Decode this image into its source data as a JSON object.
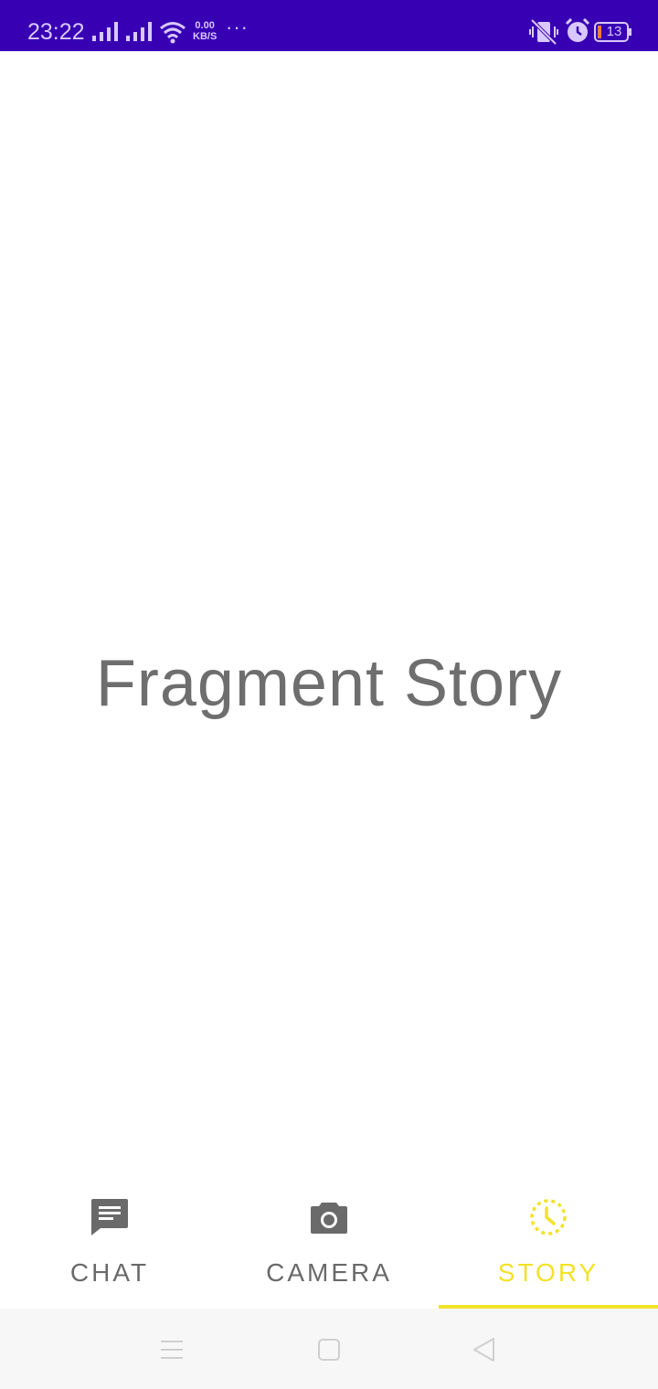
{
  "status_bar": {
    "time": "23:22",
    "net_speed_value": "0.00",
    "net_speed_unit": "KB/S",
    "more_indicator": "···",
    "battery_level": "13",
    "icons": [
      "signal-icon",
      "signal-icon",
      "wifi-icon",
      "vibrate-off-icon",
      "alarm-icon",
      "battery-icon"
    ]
  },
  "main": {
    "fragment_text": "Fragment Story"
  },
  "tabs": [
    {
      "label": "CHAT",
      "icon": "chat-icon",
      "selected": false
    },
    {
      "label": "CAMERA",
      "icon": "camera-icon",
      "selected": false
    },
    {
      "label": "STORY",
      "icon": "story-icon",
      "selected": true
    }
  ],
  "colors": {
    "status_bar": "#3700b3",
    "accent": "#f2e22a",
    "inactive": "#6a6a6a",
    "text": "#6e6e6e",
    "nav_bar": "#f7f7f7"
  },
  "nav_bar": {
    "buttons": [
      "menu-icon",
      "home-icon",
      "back-icon"
    ]
  }
}
